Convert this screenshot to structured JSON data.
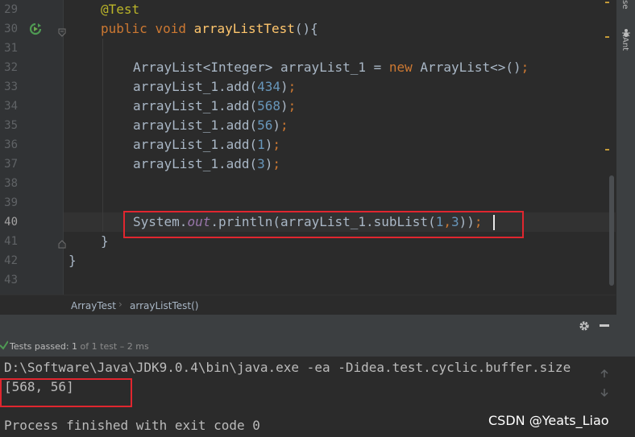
{
  "editor": {
    "line_numbers": [
      "29",
      "30",
      "31",
      "32",
      "33",
      "34",
      "35",
      "36",
      "37",
      "38",
      "39",
      "40",
      "41",
      "42",
      "43"
    ],
    "lines": [
      {
        "num": "29",
        "tokens": [
          {
            "cls": "ann",
            "t": "@Test"
          }
        ]
      },
      {
        "num": "30",
        "tokens": [
          {
            "cls": "kw",
            "t": "public "
          },
          {
            "cls": "kw",
            "t": "void "
          },
          {
            "cls": "fn",
            "t": "arrayListTest"
          },
          {
            "cls": "plain",
            "t": "(){"
          }
        ]
      },
      {
        "num": "31",
        "tokens": []
      },
      {
        "num": "32",
        "tokens": [
          {
            "cls": "plain",
            "t": "ArrayList<Integer> arrayList_1 = "
          },
          {
            "cls": "kw",
            "t": "new "
          },
          {
            "cls": "plain",
            "t": "ArrayList<>()"
          },
          {
            "cls": "kw",
            "t": ";"
          }
        ]
      },
      {
        "num": "33",
        "tokens": [
          {
            "cls": "plain",
            "t": "arrayList_1.add("
          },
          {
            "cls": "num",
            "t": "434"
          },
          {
            "cls": "plain",
            "t": ")"
          },
          {
            "cls": "kw",
            "t": ";"
          }
        ]
      },
      {
        "num": "34",
        "tokens": [
          {
            "cls": "plain",
            "t": "arrayList_1.add("
          },
          {
            "cls": "num",
            "t": "568"
          },
          {
            "cls": "plain",
            "t": ")"
          },
          {
            "cls": "kw",
            "t": ";"
          }
        ]
      },
      {
        "num": "35",
        "tokens": [
          {
            "cls": "plain",
            "t": "arrayList_1.add("
          },
          {
            "cls": "num",
            "t": "56"
          },
          {
            "cls": "plain",
            "t": ")"
          },
          {
            "cls": "kw",
            "t": ";"
          }
        ]
      },
      {
        "num": "36",
        "tokens": [
          {
            "cls": "plain",
            "t": "arrayList_1.add("
          },
          {
            "cls": "num",
            "t": "1"
          },
          {
            "cls": "plain",
            "t": ")"
          },
          {
            "cls": "kw",
            "t": ";"
          }
        ]
      },
      {
        "num": "37",
        "tokens": [
          {
            "cls": "plain",
            "t": "arrayList_1.add("
          },
          {
            "cls": "num",
            "t": "3"
          },
          {
            "cls": "plain",
            "t": ")"
          },
          {
            "cls": "kw",
            "t": ";"
          }
        ]
      },
      {
        "num": "38",
        "tokens": []
      },
      {
        "num": "39",
        "tokens": []
      },
      {
        "num": "40",
        "tokens": [
          {
            "cls": "plain",
            "t": "System."
          },
          {
            "cls": "field",
            "t": "out"
          },
          {
            "cls": "plain",
            "t": ".println(arrayList_1.subList("
          },
          {
            "cls": "num",
            "t": "1"
          },
          {
            "cls": "kw",
            "t": ","
          },
          {
            "cls": "num",
            "t": "3"
          },
          {
            "cls": "plain",
            "t": "))"
          },
          {
            "cls": "kw",
            "t": ";"
          }
        ]
      },
      {
        "num": "41",
        "tokens": [
          {
            "cls": "plain",
            "t": "}"
          }
        ]
      },
      {
        "num": "42",
        "tokens": [
          {
            "cls": "plain",
            "t": "}"
          }
        ]
      },
      {
        "num": "43",
        "tokens": []
      }
    ]
  },
  "right_strip": {
    "tab_top": "se",
    "tab_ant": "Ant"
  },
  "breadcrumb": {
    "class_name": "ArrayTest",
    "separator": "›",
    "method_name": "arrayListTest()"
  },
  "run": {
    "status_prefix": "Tests passed:",
    "status_count": "1",
    "status_rest": "of 1 test – 2 ms"
  },
  "console": {
    "command": "D:\\Software\\Java\\JDK9.0.4\\bin\\java.exe -ea -Didea.test.cyclic.buffer.size",
    "output": "[568, 56]",
    "exit": "Process finished with exit code 0"
  },
  "watermark": "CSDN @Yeats_Liao",
  "colors": {
    "highlight_box": "#e0262f",
    "keyword": "#cc7832",
    "annotation": "#bbb529",
    "number": "#6897bb",
    "method": "#ffc66d",
    "success": "#4e9a53"
  }
}
